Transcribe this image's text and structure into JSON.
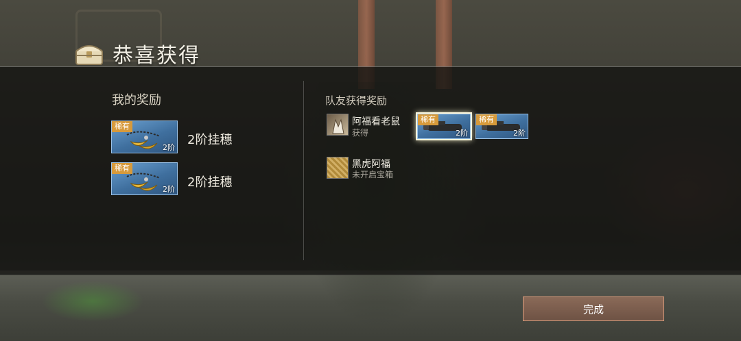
{
  "dialog": {
    "title": "恭喜获得",
    "done_label": "完成"
  },
  "my_rewards": {
    "heading": "我的奖励",
    "items": [
      {
        "rarity": "稀有",
        "tier": "2阶",
        "name": "2阶挂穗",
        "icon": "golden-pendant-icon"
      },
      {
        "rarity": "稀有",
        "tier": "2阶",
        "name": "2阶挂穗",
        "icon": "golden-pendant-icon"
      }
    ]
  },
  "teammates": {
    "heading": "队友获得奖励",
    "members": [
      {
        "name": "阿福看老鼠",
        "status": "获得",
        "avatar": "fox-avatar",
        "items": [
          {
            "rarity": "稀有",
            "tier": "2阶",
            "icon": "scope-icon",
            "selected": true
          },
          {
            "rarity": "稀有",
            "tier": "2阶",
            "icon": "scope-icon",
            "selected": false
          }
        ]
      },
      {
        "name": "黑虎阿福",
        "status": "未开启宝箱",
        "avatar": "gold-avatar",
        "items": []
      }
    ]
  },
  "colors": {
    "rarity_badge": "#d79a3b",
    "card_blue": "#4f80b2",
    "button_border": "#d99c7c"
  }
}
